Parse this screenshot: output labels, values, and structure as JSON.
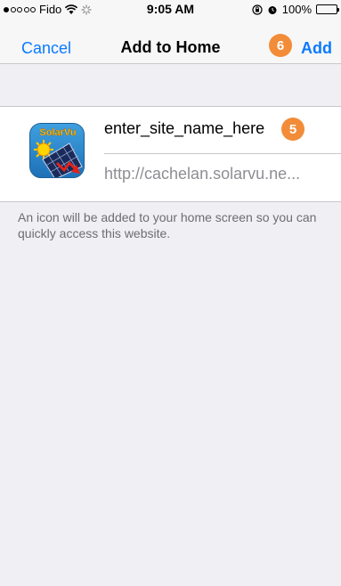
{
  "status_bar": {
    "carrier": "Fido",
    "time": "9:05 AM",
    "battery": "100%"
  },
  "nav": {
    "cancel_label": "Cancel",
    "title": "Add to Home",
    "add_label": "Add",
    "step_badge": "6"
  },
  "form": {
    "site_name": "enter_site_name_here",
    "name_badge": "5",
    "url": "http://cachelan.solarvu.ne...",
    "icon_text": "SolarVu"
  },
  "info": {
    "text": "An icon will be added to your home screen so you can quickly access this website."
  },
  "colors": {
    "accent": "#0a7aff",
    "badge": "#f28c38",
    "background": "#efeff4"
  }
}
